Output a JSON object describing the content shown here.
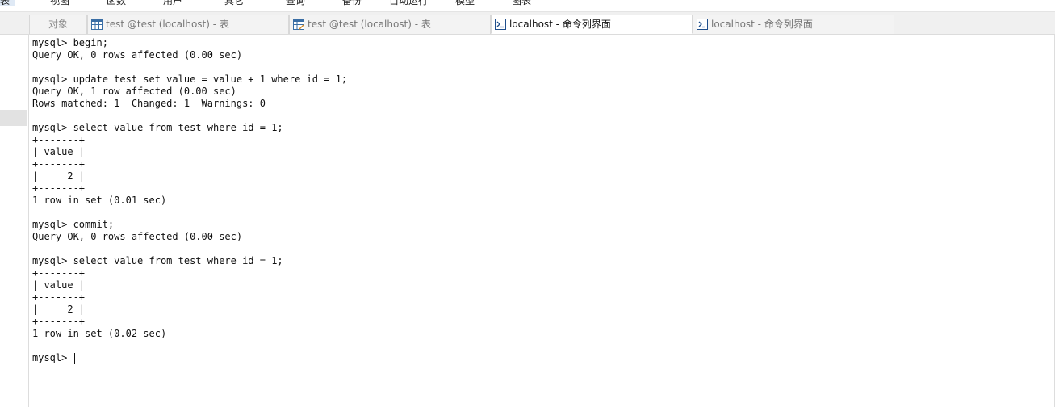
{
  "menubar": {
    "items": [
      "表",
      "视图",
      "函数",
      "用户",
      "其它",
      "查询",
      "备份",
      "自动运行",
      "模型",
      "图表"
    ]
  },
  "tabs": [
    {
      "label": "对象",
      "icon": "none",
      "active": false
    },
    {
      "label": "test @test (localhost) - 表",
      "icon": "table-grid-icon",
      "active": false
    },
    {
      "label": "test @test (localhost) - 表",
      "icon": "table-edit-icon",
      "active": false
    },
    {
      "label": "localhost - 命令列界面",
      "icon": "terminal-icon",
      "active": true
    },
    {
      "label": "localhost - 命令列界面",
      "icon": "terminal-icon",
      "active": false
    }
  ],
  "console": {
    "lines": [
      "mysql> begin;",
      "Query OK, 0 rows affected (0.00 sec)",
      "",
      "mysql> update test set value = value + 1 where id = 1;",
      "Query OK, 1 row affected (0.00 sec)",
      "Rows matched: 1  Changed: 1  Warnings: 0",
      "",
      "mysql> select value from test where id = 1;",
      "+-------+",
      "| value |",
      "+-------+",
      "|     2 |",
      "+-------+",
      "1 row in set (0.01 sec)",
      "",
      "mysql> commit;",
      "Query OK, 0 rows affected (0.00 sec)",
      "",
      "mysql> select value from test where id = 1;",
      "+-------+",
      "| value |",
      "+-------+",
      "|     2 |",
      "+-------+",
      "1 row in set (0.02 sec)",
      ""
    ],
    "prompt": "mysql> "
  },
  "colors": {
    "tab_bar": "#f0f0f0",
    "active_tab": "#ffffff",
    "text": "#111111",
    "terminal_icon": "#1f4e8c"
  }
}
